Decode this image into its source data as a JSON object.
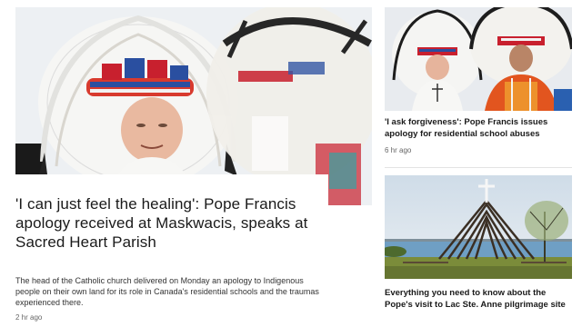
{
  "main_story": {
    "title": "'I can just feel the healing': Pope Francis apology received at Maskwacis, speaks at Sacred Heart Parish",
    "summary": "The head of the Catholic church delivered on Monday an apology to Indigenous people on their own land for its role in Canada's residential schools and the traumas experienced there.",
    "time": "2 hr ago"
  },
  "side_stories": [
    {
      "title": "'I ask forgiveness': Pope Francis issues apology for residential school abuses",
      "time": "6 hr ago"
    },
    {
      "title": "Everything you need to know about the Pope's visit to Lac Ste. Anne pilgrimage site",
      "time": ""
    }
  ],
  "colors": {
    "text": "#1a1a1a",
    "meta": "#666666",
    "headdress_red": "#c8202e",
    "headdress_blue": "#2a4fa0",
    "sky": "#a9c9e6",
    "lake": "#6f9fc4",
    "grass": "#7b8c3a"
  },
  "icons": [
    "headdress-photo",
    "cross-shelter-photo"
  ]
}
